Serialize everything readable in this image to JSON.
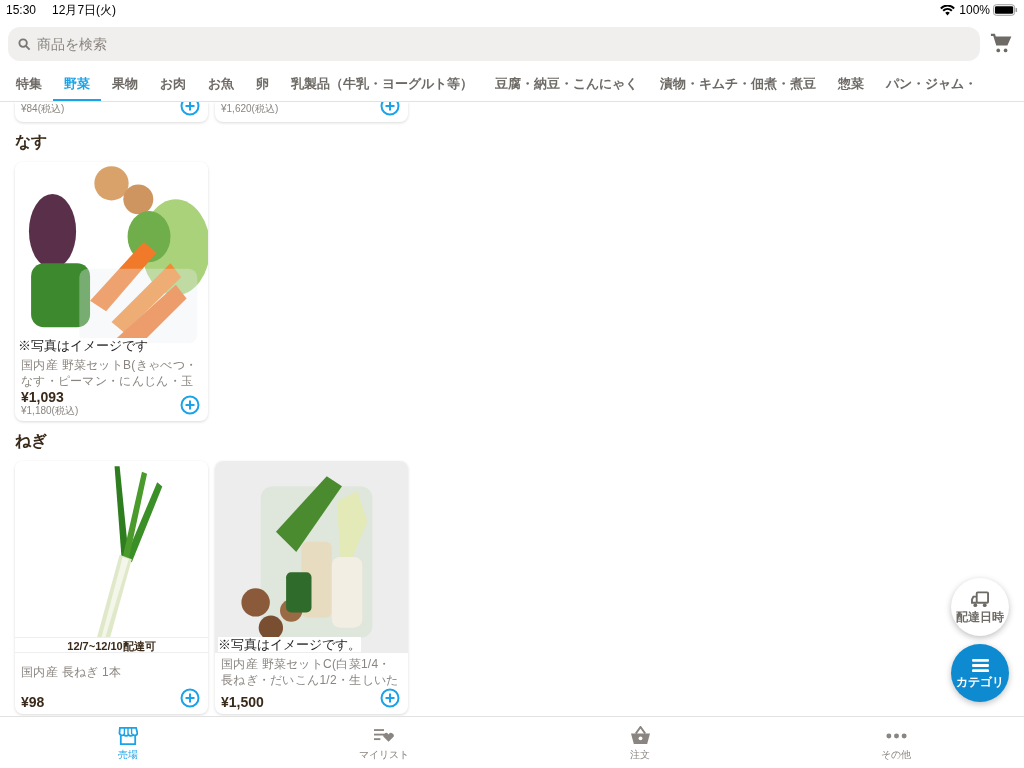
{
  "status_bar": {
    "time": "15:30",
    "date": "12月7日(火)",
    "battery": "100%"
  },
  "search": {
    "placeholder": "商品を検索"
  },
  "category_tabs": [
    {
      "label": "特集",
      "selected": false
    },
    {
      "label": "野菜",
      "selected": true
    },
    {
      "label": "果物",
      "selected": false
    },
    {
      "label": "お肉",
      "selected": false
    },
    {
      "label": "お魚",
      "selected": false
    },
    {
      "label": "卵",
      "selected": false
    },
    {
      "label": "乳製品（牛乳・ヨーグルト等）",
      "selected": false
    },
    {
      "label": "豆腐・納豆・こんにゃく",
      "selected": false
    },
    {
      "label": "漬物・キムチ・佃煮・煮豆",
      "selected": false
    },
    {
      "label": "惣菜",
      "selected": false
    },
    {
      "label": "パン・ジャム・",
      "selected": false
    }
  ],
  "top_cards": [
    {
      "tax_price": "¥84(税込)"
    },
    {
      "tax_price": "¥1,620(税込)"
    }
  ],
  "sections": [
    {
      "title": "なす",
      "products": [
        {
          "image_caption": "※写真はイメージです",
          "name": "国内産 野菜セットB(きゃべつ・なす・ピーマン・にんじん・玉",
          "price": "¥1,093",
          "tax_price": "¥1,180(税込)"
        }
      ]
    },
    {
      "title": "ねぎ",
      "products": [
        {
          "delivery_badge": "12/7~12/10配達可",
          "name": "国内産 長ねぎ 1本",
          "price": "¥98"
        },
        {
          "image_caption": "※写真はイメージです。",
          "name": "国内産 野菜セットC(白菜1/4・長ねぎ・だいこん1/2・生しいた",
          "price": "¥1,500"
        }
      ]
    }
  ],
  "floating_buttons": [
    {
      "kind": "delivery",
      "label": "配達日時"
    },
    {
      "kind": "category",
      "label": "カテゴリ"
    }
  ],
  "bottom_tabs": [
    {
      "kind": "store",
      "label": "売場",
      "selected": true
    },
    {
      "kind": "mylist",
      "label": "マイリスト",
      "selected": false
    },
    {
      "kind": "order",
      "label": "注文",
      "selected": false
    },
    {
      "kind": "more",
      "label": "その他",
      "selected": false
    }
  ]
}
